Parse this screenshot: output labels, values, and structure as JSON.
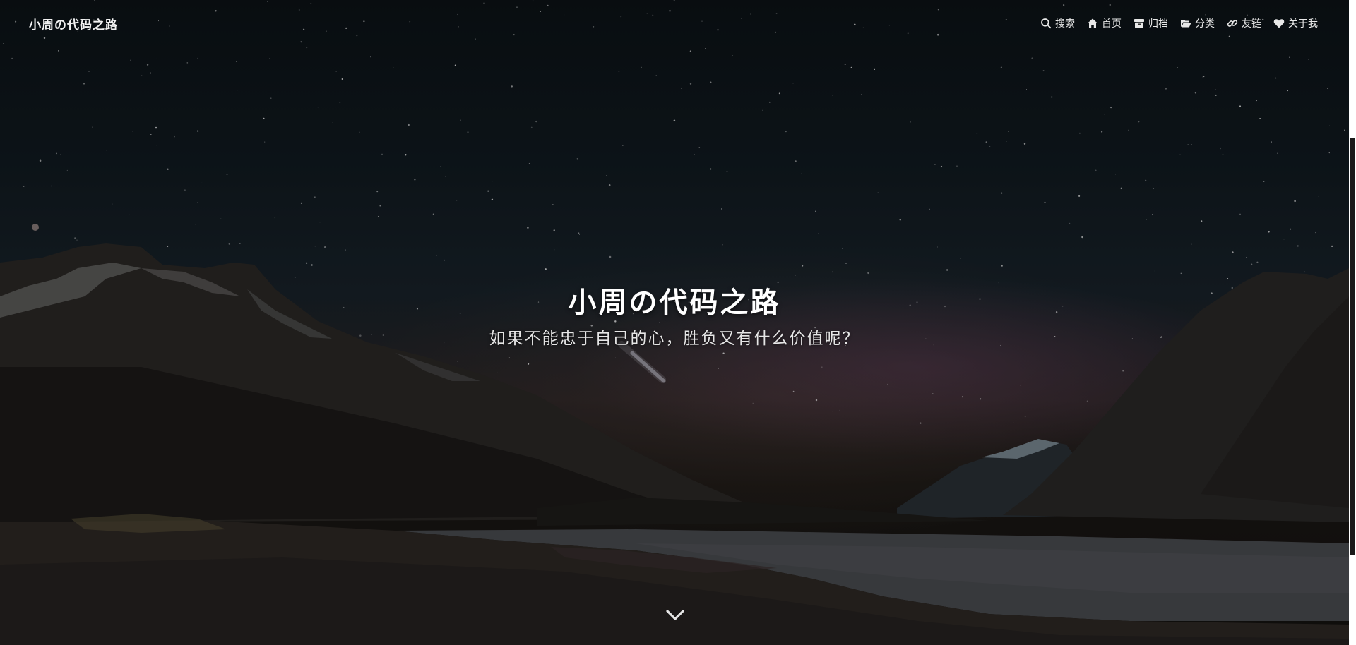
{
  "site": {
    "brand": "小周の代码之路",
    "title": "小周の代码之路",
    "subtitle": "如果不能忠于自己的心，胜负又有什么价值呢？"
  },
  "nav": {
    "items": [
      {
        "label": "搜索",
        "icon": "search-icon"
      },
      {
        "label": "首页",
        "icon": "home-icon"
      },
      {
        "label": "归档",
        "icon": "archive-icon"
      },
      {
        "label": "分类",
        "icon": "folder-open-icon"
      },
      {
        "label": "友链",
        "icon": "link-icon"
      },
      {
        "label": "关于我",
        "icon": "heart-icon"
      }
    ]
  },
  "hero": {
    "scroll_icon": "chevron-down-icon"
  },
  "colors": {
    "text": "#ffffff",
    "nav_text": "#e8e8e8"
  }
}
